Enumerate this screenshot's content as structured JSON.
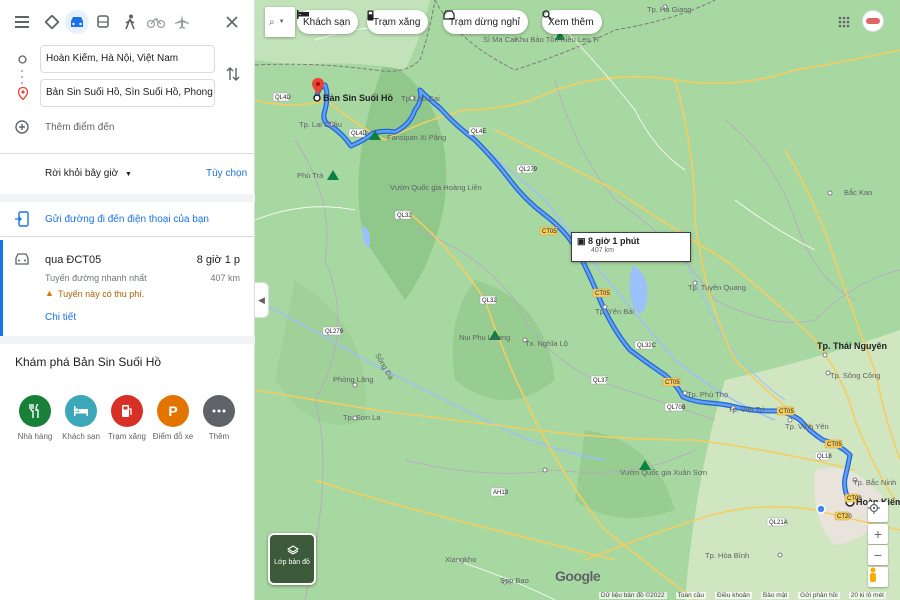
{
  "panel": {
    "modes": [
      "menu-icon",
      "best-route-icon",
      "car-icon",
      "transit-icon",
      "walk-icon",
      "bike-icon",
      "flight-icon",
      "close-icon"
    ],
    "origin": "Hoàn Kiếm, Hà Nội, Việt Nam",
    "destination": "Bản Sin Suối Hồ, Sìn Suối Hồ, Phong Thổ",
    "add_destination": "Thêm điểm đến",
    "depart": "Rời khỏi bây giờ",
    "options": "Tùy chọn",
    "send_phone": "Gửi đường đi đến điện thoại của bạn",
    "route": {
      "via": "qua ĐCT05",
      "time": "8 giờ 1 p",
      "subtitle": "Tuyến đường nhanh nhất",
      "distance": "407 km",
      "warning": "Tuyến này có thu phí.",
      "details": "Chi tiết"
    },
    "explore_title": "Khám phá Bản Sin Suối Hồ",
    "categories": [
      {
        "label": "Nhà hàng",
        "color": "#188038"
      },
      {
        "label": "Khách sạn",
        "color": "#3ba7b8"
      },
      {
        "label": "Trạm xăng",
        "color": "#d93025"
      },
      {
        "label": "Điểm đỗ xe",
        "color": "#e37400"
      },
      {
        "label": "Thêm",
        "color": "#5f6368"
      }
    ]
  },
  "map": {
    "chips": [
      "Khách sạn",
      "Trạm xăng",
      "Trạm dừng nghỉ",
      "Xem thêm"
    ],
    "route_box": {
      "time": "8 giờ 1 phút",
      "distance": "407 km"
    },
    "destination_label": "Bản Sin Suối Hồ",
    "origin_label": "Hoàn Kiếm",
    "layer_label": "Lớp bản đồ",
    "google": "Google",
    "footer": [
      "Dữ liệu bản đồ ©2022",
      "Toàn cầu",
      "Điều khoản",
      "Bảo mật",
      "Gửi phản hồi",
      "20 ki lô mét"
    ],
    "places": [
      {
        "name": "Tp. Hà Giang"
      },
      {
        "name": "Sì Ma Cai"
      },
      {
        "name": "Khu Bảo Tồn Kiều Leo Tí"
      },
      {
        "name": "Tp. Lào Cai"
      },
      {
        "name": "Tp. Lai Châu"
      },
      {
        "name": "Fansipan Xi Păng"
      },
      {
        "name": "Phù Trà"
      },
      {
        "name": "Vườn Quốc gia Hoàng Liên"
      },
      {
        "name": "Tp. Tuyên Quang"
      },
      {
        "name": "Tp. Yên Bái"
      },
      {
        "name": "Nui Phu Lương"
      },
      {
        "name": "Tx. Nghĩa Lộ"
      },
      {
        "name": "Sông Đà"
      },
      {
        "name": "Phòng Lăng"
      },
      {
        "name": "Tp. Sơn La"
      },
      {
        "name": "Tp. Phú Thọ"
      },
      {
        "name": "Tp. Việt Trì"
      },
      {
        "name": "Tp. Vĩnh Yên"
      },
      {
        "name": "Tp. Thái Nguyên"
      },
      {
        "name": "Tp. Sông Công"
      },
      {
        "name": "Vườn Quốc gia Xuân Sơn"
      },
      {
        "name": "Tp. Hòa Bình"
      },
      {
        "name": "Xiangkho"
      },
      {
        "name": "Sop Bao"
      },
      {
        "name": "Bắc Kan"
      },
      {
        "name": "Tp. Bắc Ninh"
      }
    ]
  }
}
